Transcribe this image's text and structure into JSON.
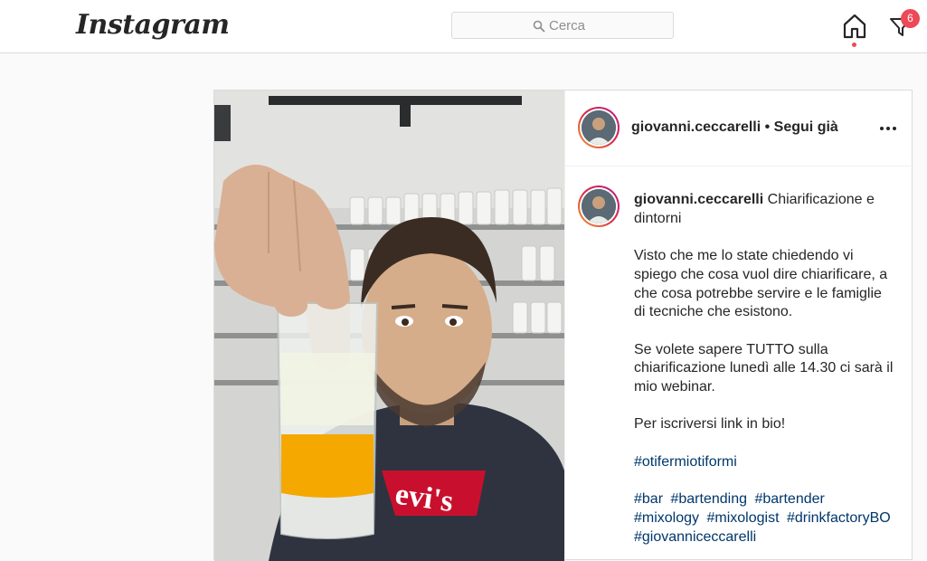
{
  "header": {
    "logo": "Instagram",
    "search_placeholder": "Cerca",
    "notification_count": "6"
  },
  "post": {
    "username": "giovanni.ceccarelli",
    "follow_state": " • Segui già",
    "caption_title": "Chiarificazione e dintorni",
    "caption_paragraphs": [
      "Visto che me lo state chiedendo vi spiego che cosa vuol dire chiarificare, a che cosa potrebbe servire e le famiglie di tecniche che esistono.",
      "Se volete sapere TUTTO sulla chiarificazione lunedì alle 14.30 ci sarà il mio webinar.",
      "Per iscriversi link in bio!"
    ],
    "hashtag_single": "#otifermiotiformi",
    "hashtags": [
      "#bar",
      "#bartending",
      "#bartender",
      "#mixology",
      "#mixologist",
      "#drinkfactoryBO",
      "#giovanniceccarelli"
    ]
  },
  "colors": {
    "accent_link": "#00376b",
    "notification": "#ed4956",
    "juice": "#f5a800"
  },
  "icons": [
    "search-icon",
    "home-icon",
    "filter-icon",
    "more-options-icon"
  ]
}
